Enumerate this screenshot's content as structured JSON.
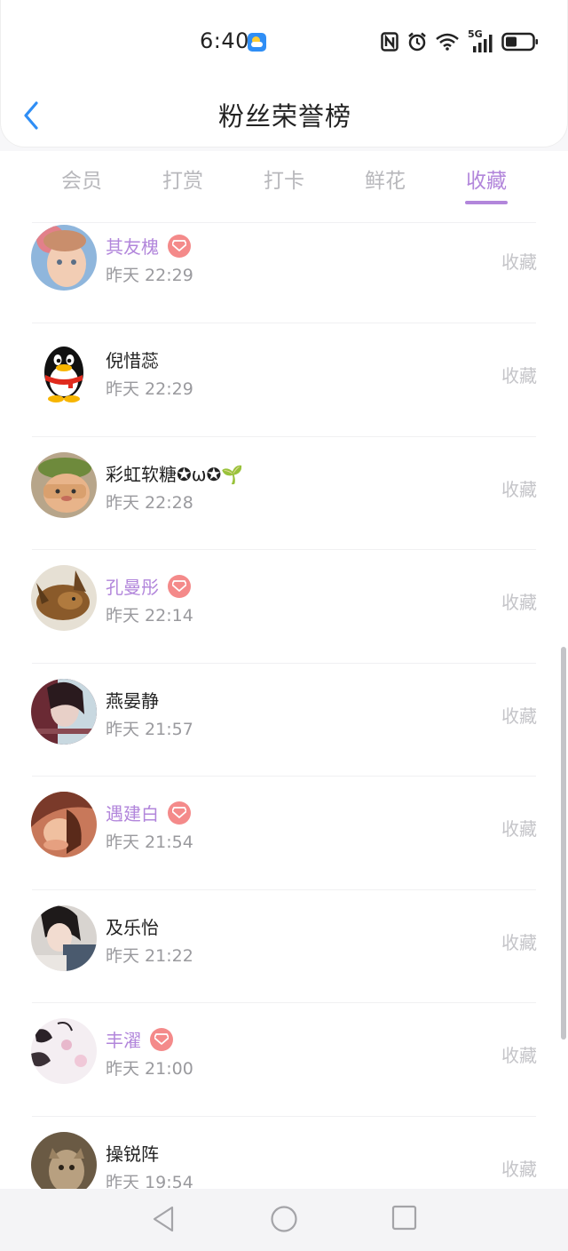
{
  "status_bar": {
    "time": "6:40",
    "icons": [
      "weather-icon",
      "nfc-icon",
      "alarm-icon",
      "wifi-icon",
      "signal-5g-icon",
      "battery-icon"
    ],
    "network_label": "5G"
  },
  "header": {
    "title": "粉丝荣誉榜",
    "back_icon": "chevron-left-icon"
  },
  "tabs": [
    {
      "label": "会员",
      "active": false
    },
    {
      "label": "打赏",
      "active": false
    },
    {
      "label": "打卡",
      "active": false
    },
    {
      "label": "鲜花",
      "active": false
    },
    {
      "label": "收藏",
      "active": true
    }
  ],
  "colors": {
    "accent": "#b286db",
    "badge": "#f48a8a",
    "back_arrow": "#2f8ef5"
  },
  "rows": [
    {
      "name": "其友槐",
      "vip": true,
      "time": "昨天 22:29",
      "action": "收藏"
    },
    {
      "name": "倪惜蕊",
      "vip": false,
      "time": "昨天 22:29",
      "action": "收藏"
    },
    {
      "name": "彩虹软糖✪ω✪🌱",
      "vip": false,
      "time": "昨天 22:28",
      "action": "收藏"
    },
    {
      "name": "孔曼彤",
      "vip": true,
      "time": "昨天 22:14",
      "action": "收藏"
    },
    {
      "name": "燕晏静",
      "vip": false,
      "time": "昨天 21:57",
      "action": "收藏"
    },
    {
      "name": "遇建白",
      "vip": true,
      "time": "昨天 21:54",
      "action": "收藏"
    },
    {
      "name": "及乐怡",
      "vip": false,
      "time": "昨天 21:22",
      "action": "收藏"
    },
    {
      "name": "丰濯",
      "vip": true,
      "time": "昨天 21:00",
      "action": "收藏"
    },
    {
      "name": "操锐阵",
      "vip": false,
      "time": "昨天 19:54",
      "action": "收藏"
    }
  ],
  "nav_bar": {
    "icons": [
      "back-triangle-icon",
      "home-circle-icon",
      "recents-square-icon"
    ]
  }
}
